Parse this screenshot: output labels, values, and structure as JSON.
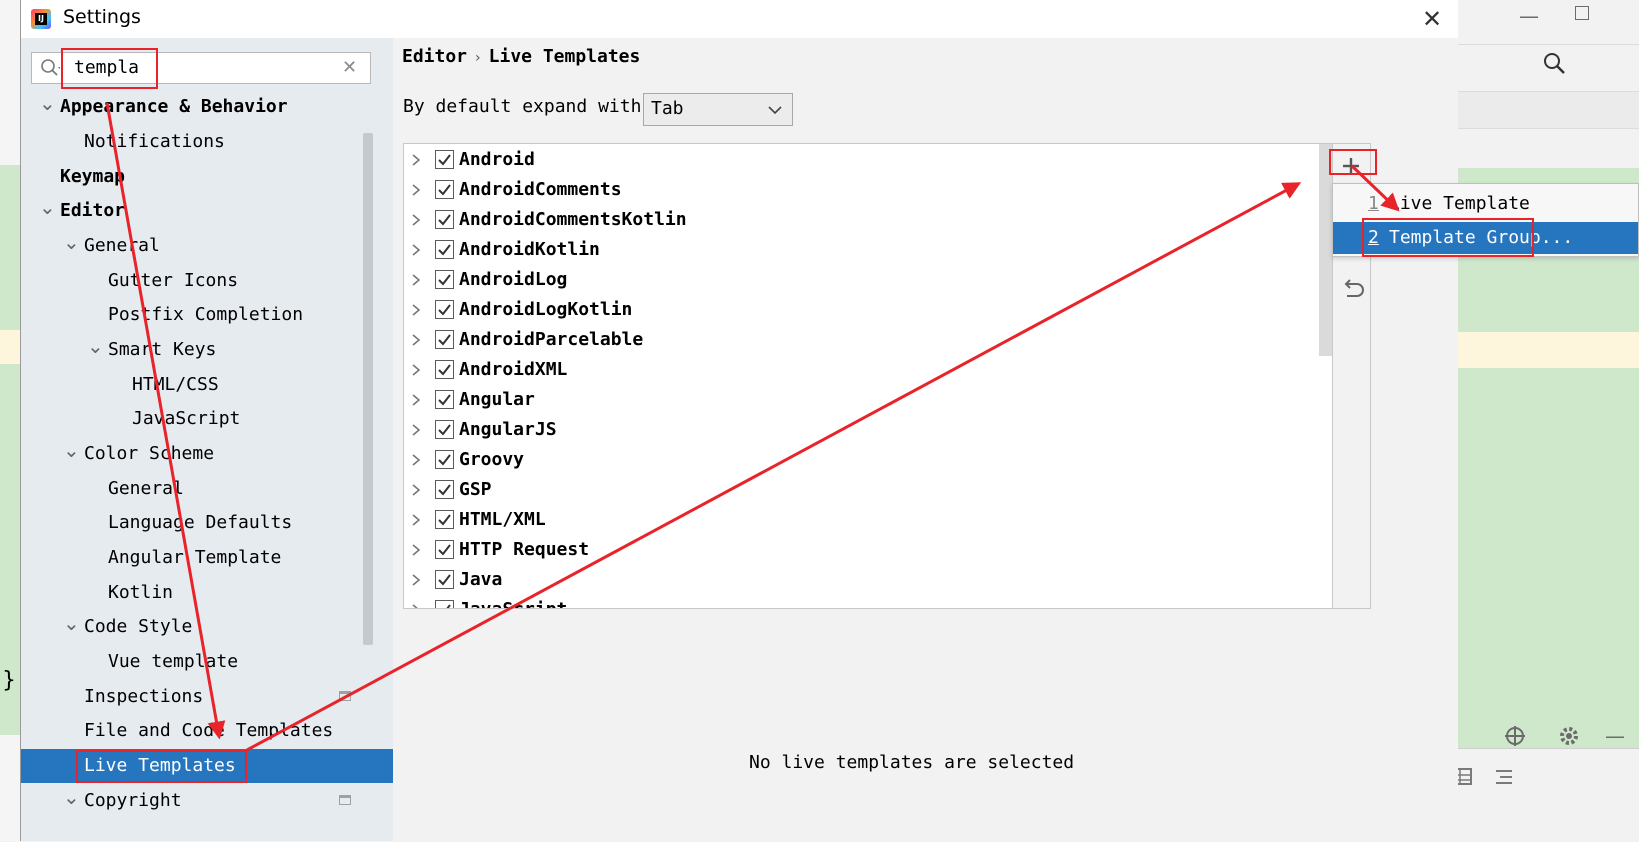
{
  "dialog": {
    "title": "Settings",
    "app_icon_glyph": "IJ"
  },
  "search": {
    "value": "templa",
    "clear_glyph": "✕"
  },
  "tree": {
    "items": [
      {
        "label": "Appearance & Behavior",
        "bold": true,
        "expanded": true
      },
      {
        "label": "Notifications"
      },
      {
        "label": "Keymap",
        "bold": true
      },
      {
        "label": "Editor",
        "bold": true,
        "expanded": true
      },
      {
        "label": "General",
        "expanded": true
      },
      {
        "label": "Gutter Icons"
      },
      {
        "label": "Postfix Completion"
      },
      {
        "label": "Smart Keys",
        "expanded": true
      },
      {
        "label": "HTML/CSS"
      },
      {
        "label": "JavaScript"
      },
      {
        "label": "Color Scheme",
        "expanded": true
      },
      {
        "label": "General"
      },
      {
        "label": "Language Defaults"
      },
      {
        "label": "Angular Template"
      },
      {
        "label": "Kotlin"
      },
      {
        "label": "Code Style",
        "expanded": true
      },
      {
        "label": "Vue template"
      },
      {
        "label": "Inspections"
      },
      {
        "label": "File and Code Templates"
      },
      {
        "label": "Live Templates",
        "selected": true
      },
      {
        "label": "Copyright",
        "expanded": true
      }
    ]
  },
  "breadcrumb": {
    "parent": "Editor",
    "separator": "›",
    "current": "Live Templates"
  },
  "expand": {
    "label": "By default expand with",
    "value": "Tab"
  },
  "templates": [
    {
      "name": "Android",
      "checked": true
    },
    {
      "name": "AndroidComments",
      "checked": true
    },
    {
      "name": "AndroidCommentsKotlin",
      "checked": true
    },
    {
      "name": "AndroidKotlin",
      "checked": true
    },
    {
      "name": "AndroidLog",
      "checked": true
    },
    {
      "name": "AndroidLogKotlin",
      "checked": true
    },
    {
      "name": "AndroidParcelable",
      "checked": true
    },
    {
      "name": "AndroidXML",
      "checked": true
    },
    {
      "name": "Angular",
      "checked": true
    },
    {
      "name": "AngularJS",
      "checked": true
    },
    {
      "name": "Groovy",
      "checked": true
    },
    {
      "name": "GSP",
      "checked": true
    },
    {
      "name": "HTML/XML",
      "checked": true
    },
    {
      "name": "HTTP Request",
      "checked": true
    },
    {
      "name": "Java",
      "checked": true
    },
    {
      "name": "JavaScript",
      "checked": true
    }
  ],
  "popup": {
    "items": [
      {
        "mnemonic": "1",
        "label": "Live Template",
        "selected": false
      },
      {
        "mnemonic": "2",
        "label": "Template Group...",
        "selected": true
      }
    ]
  },
  "status": {
    "empty_message": "No live templates are selected"
  },
  "colors": {
    "accent_selection": "#2675bf",
    "annotation_red": "#e8232a",
    "nav_background": "#e6ebf0",
    "editor_green": "#cfe8cc"
  },
  "icons": {
    "add": "plus-icon",
    "revert": "undo-icon",
    "search": "search-icon",
    "close": "close-icon"
  }
}
